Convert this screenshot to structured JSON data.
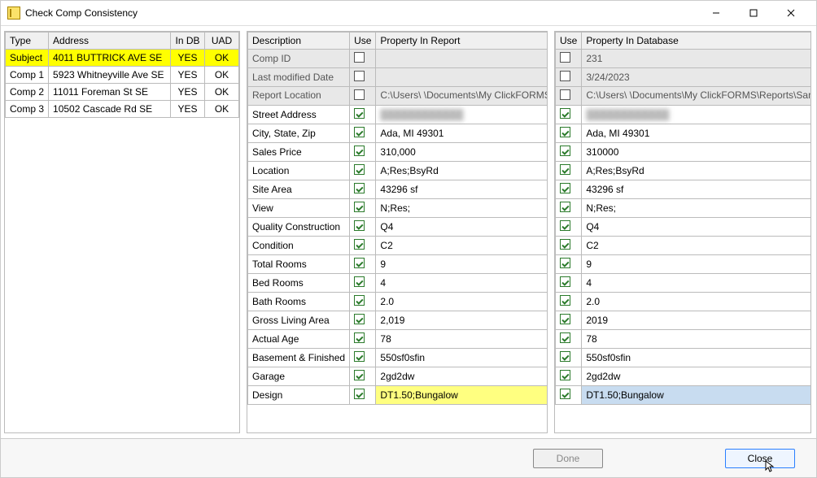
{
  "window": {
    "title": "Check Comp Consistency"
  },
  "left": {
    "headers": {
      "type": "Type",
      "address": "Address",
      "indb": "In DB",
      "uad": "UAD"
    },
    "rows": [
      {
        "type": "Subject",
        "address": "4011 BUTTRICK AVE SE",
        "indb": "YES",
        "uad": "OK",
        "hl": true
      },
      {
        "type": "Comp 1",
        "address": "5923 Whitneyville Ave SE",
        "indb": "YES",
        "uad": "OK"
      },
      {
        "type": "Comp 2",
        "address": "11011 Foreman St SE",
        "indb": "YES",
        "uad": "OK"
      },
      {
        "type": "Comp 3",
        "address": "10502 Cascade Rd SE",
        "indb": "YES",
        "uad": "OK"
      }
    ]
  },
  "mid": {
    "headers": {
      "desc": "Description",
      "use": "Use",
      "val": "Property In Report"
    }
  },
  "right": {
    "headers": {
      "use": "Use",
      "val": "Property In  Database"
    }
  },
  "rows": [
    {
      "desc": "Comp ID",
      "use1": false,
      "val1": "",
      "use2": false,
      "val2": "231",
      "gray": true
    },
    {
      "desc": "Last modified Date",
      "use1": false,
      "val1": "",
      "use2": false,
      "val2": "3/24/2023",
      "gray": true
    },
    {
      "desc": "Report Location",
      "use1": false,
      "val1": "C:\\Users\\                              \\Documents\\My ClickFORMS\\Reports\\Sample File.clk",
      "use2": false,
      "val2": " C:\\Users\\                              \\Documents\\My ClickFORMS\\Reports\\Sample File.clk",
      "gray": true,
      "tall": true
    },
    {
      "desc": "Street Address",
      "use1": true,
      "val1": "████████████",
      "use2": true,
      "val2": "████████████",
      "obs": true
    },
    {
      "desc": "City, State, Zip",
      "use1": true,
      "val1": "Ada, MI 49301",
      "use2": true,
      "val2": "Ada, MI 49301"
    },
    {
      "desc": "Sales Price",
      "use1": true,
      "val1": "310,000",
      "use2": true,
      "val2": "310000"
    },
    {
      "desc": "Location",
      "use1": true,
      "val1": "A;Res;BsyRd",
      "use2": true,
      "val2": "A;Res;BsyRd"
    },
    {
      "desc": "Site Area",
      "use1": true,
      "val1": "43296 sf",
      "use2": true,
      "val2": "43296 sf"
    },
    {
      "desc": "View",
      "use1": true,
      "val1": "N;Res;",
      "use2": true,
      "val2": "N;Res;"
    },
    {
      "desc": "Quality Construction",
      "use1": true,
      "val1": "Q4",
      "use2": true,
      "val2": "Q4"
    },
    {
      "desc": "Condition",
      "use1": true,
      "val1": "C2",
      "use2": true,
      "val2": "C2"
    },
    {
      "desc": "Total Rooms",
      "use1": true,
      "val1": "9",
      "use2": true,
      "val2": "9"
    },
    {
      "desc": "Bed Rooms",
      "use1": true,
      "val1": "4",
      "use2": true,
      "val2": "4"
    },
    {
      "desc": "Bath Rooms",
      "use1": true,
      "val1": "2.0",
      "use2": true,
      "val2": "2.0"
    },
    {
      "desc": "Gross Living Area",
      "use1": true,
      "val1": "2,019",
      "use2": true,
      "val2": "2019"
    },
    {
      "desc": "Actual Age",
      "use1": true,
      "val1": "78",
      "use2": true,
      "val2": "78"
    },
    {
      "desc": "Basement & Finished",
      "use1": true,
      "val1": "550sf0sfin",
      "use2": true,
      "val2": "550sf0sfin"
    },
    {
      "desc": "Garage",
      "use1": true,
      "val1": "2gd2dw",
      "use2": true,
      "val2": "2gd2dw"
    },
    {
      "desc": "Design",
      "use1": true,
      "val1": "DT1.50;Bungalow",
      "use2": true,
      "val2": "DT1.50;Bungalow",
      "val1hl": "yellow",
      "val2hl": "blue"
    }
  ],
  "footer": {
    "done": "Done",
    "close": "Close"
  }
}
